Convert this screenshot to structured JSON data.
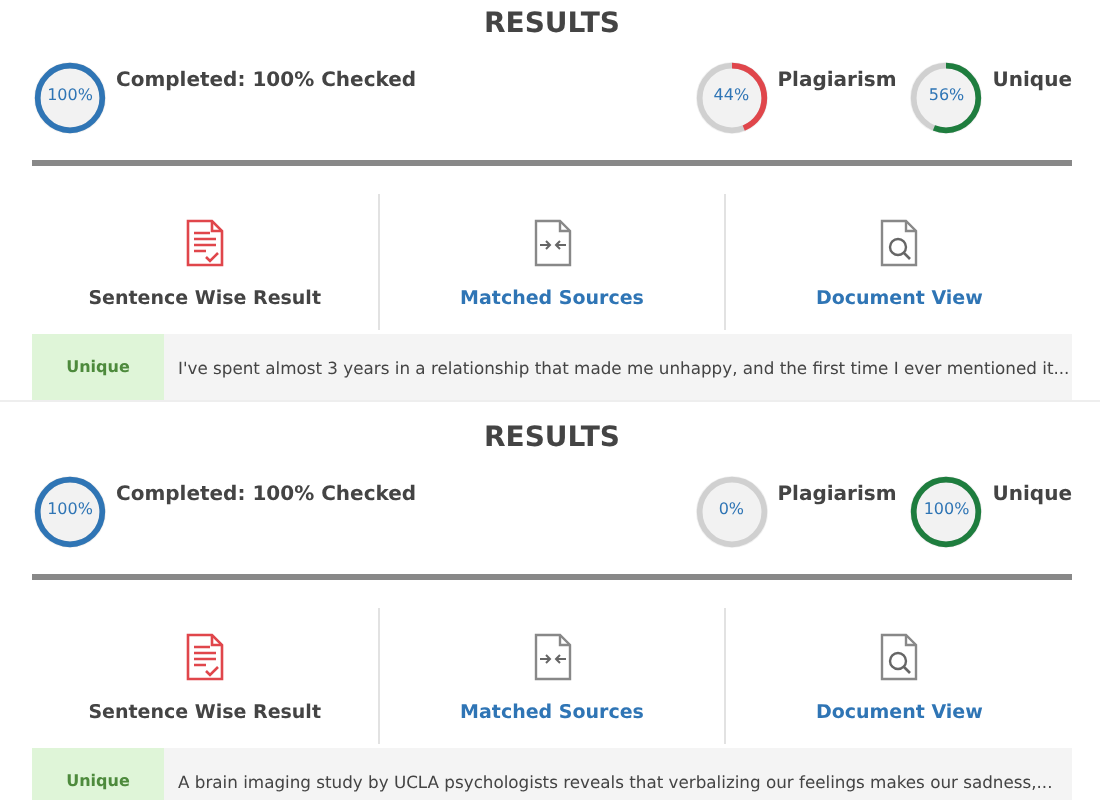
{
  "panels": [
    {
      "title": "RESULTS",
      "completed": {
        "kind": "completed",
        "value": "100%",
        "label": "Completed: 100% Checked"
      },
      "gauges": [
        {
          "kind": "plagiarism",
          "value": "44%",
          "label": "Plagiarism"
        },
        {
          "kind": "unique",
          "value": "56%",
          "label": "Unique"
        }
      ],
      "tabs": [
        {
          "kind": "sentences",
          "label": "Sentence Wise Result",
          "selected": true
        },
        {
          "kind": "sources",
          "label": "Matched Sources",
          "selected": false
        },
        {
          "kind": "document",
          "label": "Document View",
          "selected": false
        }
      ],
      "sentence": {
        "tag": "Unique",
        "text": "I've spent almost 3 years in a relationship that made me unhappy, and the first time I ever mentioned it..."
      }
    },
    {
      "title": "RESULTS",
      "completed": {
        "kind": "completed",
        "value": "100%",
        "label": "Completed: 100% Checked"
      },
      "gauges": [
        {
          "kind": "plagiarism",
          "value": "0%",
          "label": "Plagiarism"
        },
        {
          "kind": "unique",
          "value": "100%",
          "label": "Unique"
        }
      ],
      "tabs": [
        {
          "kind": "sentences",
          "label": "Sentence Wise Result",
          "selected": true
        },
        {
          "kind": "sources",
          "label": "Matched Sources",
          "selected": false
        },
        {
          "kind": "document",
          "label": "Document View",
          "selected": false
        }
      ],
      "sentence": {
        "tag": "Unique",
        "text": "A brain imaging study by UCLA psychologists reveals that verbalizing our feelings makes our sadness,..."
      }
    }
  ]
}
